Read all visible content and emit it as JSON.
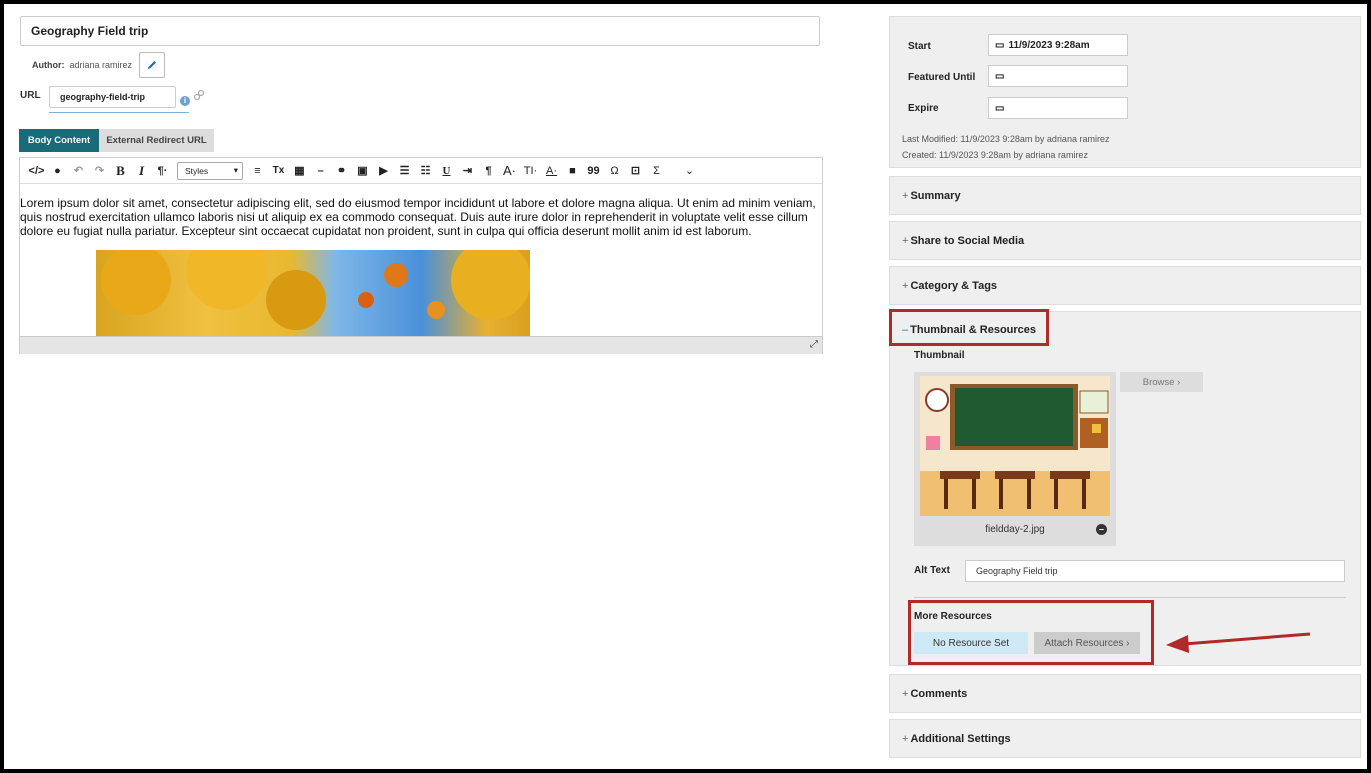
{
  "post": {
    "title": "Geography Field trip",
    "author_label": "Author:",
    "author_name": "adriana ramirez",
    "url_label": "URL",
    "url_slug": "geography-field-trip",
    "info_glyph": "i"
  },
  "tabs": {
    "body_content": "Body Content",
    "external_redirect": "External Redirect URL"
  },
  "toolbar": {
    "bold": "B",
    "italic": "I",
    "paragraph": "¶·",
    "styles": "Styles",
    "underline": "U",
    "omega": "Ω",
    "sigma": "Σ",
    "quote": "99",
    "font_size": "A·",
    "text_tools": "TI·",
    "font_color": "A·",
    "clear_format": "Tx",
    "dash": "–"
  },
  "editor": {
    "body_text": "Lorem ipsum dolor sit amet, consectetur adipiscing elit, sed do eiusmod tempor incididunt ut labore et dolore magna aliqua. Ut enim ad minim veniam, quis nostrud exercitation ullamco laboris nisi ut aliquip ex ea commodo consequat. Duis aute irure dolor in reprehenderit in voluptate velit esse cillum dolore eu fugiat nulla pariatur. Excepteur sint occaecat cupidatat non proident, sunt in culpa qui officia deserunt mollit anim id est laborum."
  },
  "dates": {
    "start_label": "Start",
    "start_value": "11/9/2023 9:28am",
    "featured_label": "Featured Until",
    "featured_value": "",
    "expire_label": "Expire",
    "expire_value": "",
    "last_modified": "Last Modified:   11/9/2023 9:28am   by adriana ramirez",
    "created": "Created:   11/9/2023 9:28am   by adriana ramirez"
  },
  "sections": {
    "summary": "Summary",
    "share": "Share to Social Media",
    "category": "Category & Tags",
    "thumbnail": "Thumbnail & Resources",
    "comments": "Comments",
    "additional": "Additional Settings",
    "plus": "+",
    "minus": "–"
  },
  "thumbnail": {
    "label": "Thumbnail",
    "filename": "fieldday-2.jpg",
    "browse": "Browse ›",
    "alt_label": "Alt Text",
    "alt_value": "Geography Field trip",
    "remove_glyph": "–"
  },
  "resources": {
    "label": "More Resources",
    "no_resource": "No Resource Set",
    "attach": "Attach Resources ›"
  },
  "colors": {
    "accent_tab": "#1a6b7a",
    "highlight_red": "#b02a2a",
    "no_resource_bg": "#cfe9f7"
  }
}
